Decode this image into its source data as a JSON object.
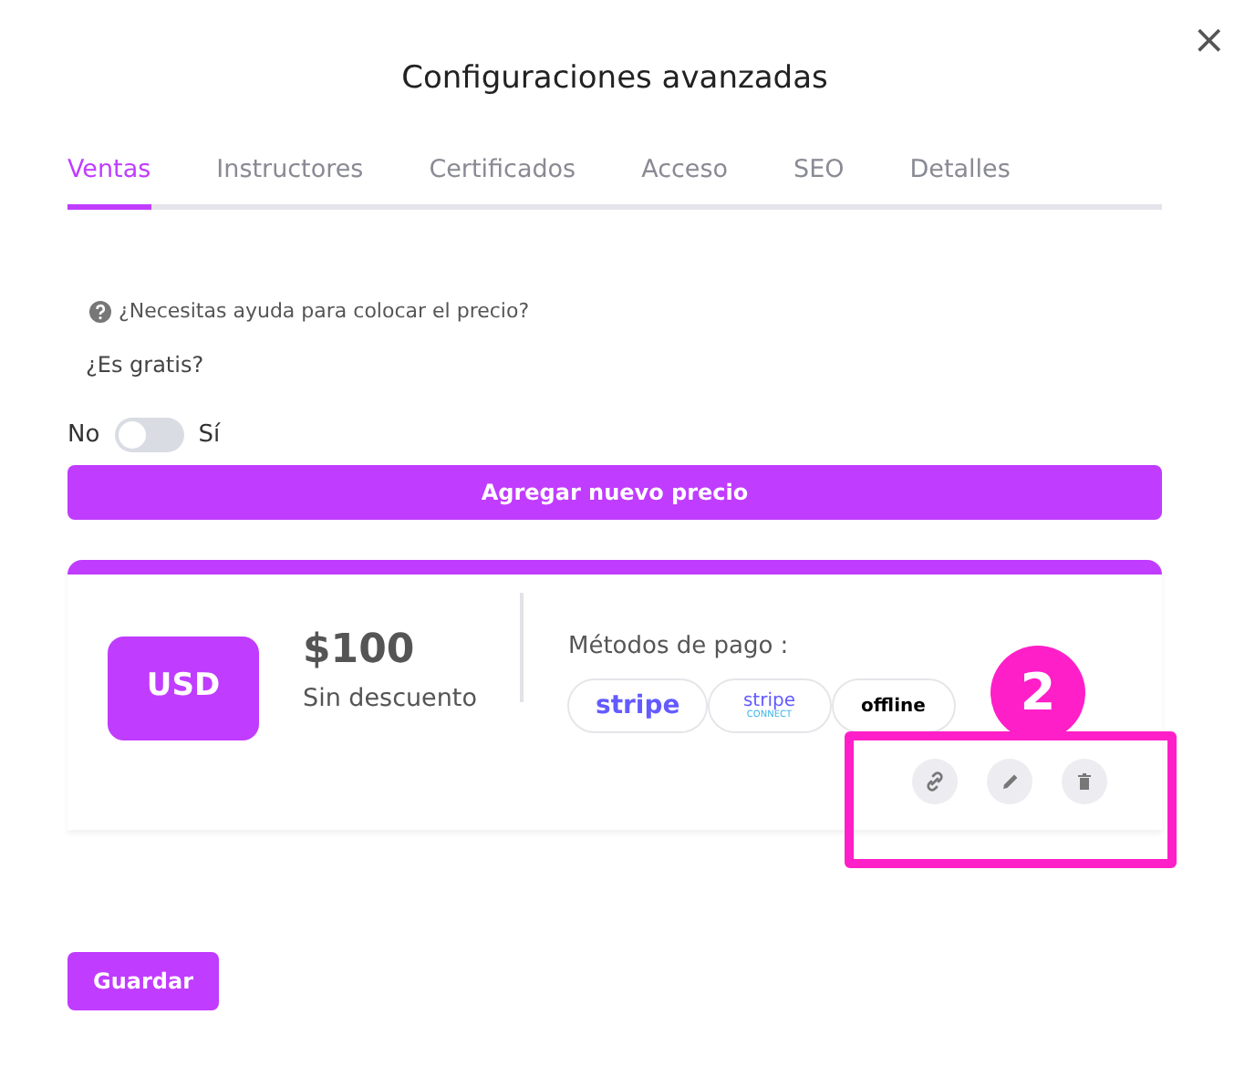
{
  "title": "Configuraciones avanzadas",
  "close": "×",
  "tabs": [
    {
      "label": "Ventas",
      "selected": true
    },
    {
      "label": "Instructores",
      "selected": false
    },
    {
      "label": "Certificados",
      "selected": false
    },
    {
      "label": "Acceso",
      "selected": false
    },
    {
      "label": "SEO",
      "selected": false
    },
    {
      "label": "Detalles",
      "selected": false
    }
  ],
  "help": "¿Necesitas ayuda para colocar el precio?",
  "free": {
    "question": "¿Es gratis?",
    "off_label": "No",
    "on_label": "Sí",
    "on": false
  },
  "add_button": "Agregar nuevo precio",
  "price": {
    "currency": "USD",
    "amount": "$100",
    "discount": "Sin descuento",
    "methods_label": "Métodos de pago :",
    "methods": [
      {
        "kind": "stripe",
        "label": "stripe"
      },
      {
        "kind": "stripe_connect",
        "label": "stripe",
        "sublabel": "CONNECT"
      },
      {
        "kind": "offline",
        "label": "offline"
      }
    ],
    "actions": [
      {
        "kind": "link"
      },
      {
        "kind": "edit"
      },
      {
        "kind": "delete"
      }
    ]
  },
  "callout": {
    "label": "2"
  },
  "save_button": "Guardar"
}
